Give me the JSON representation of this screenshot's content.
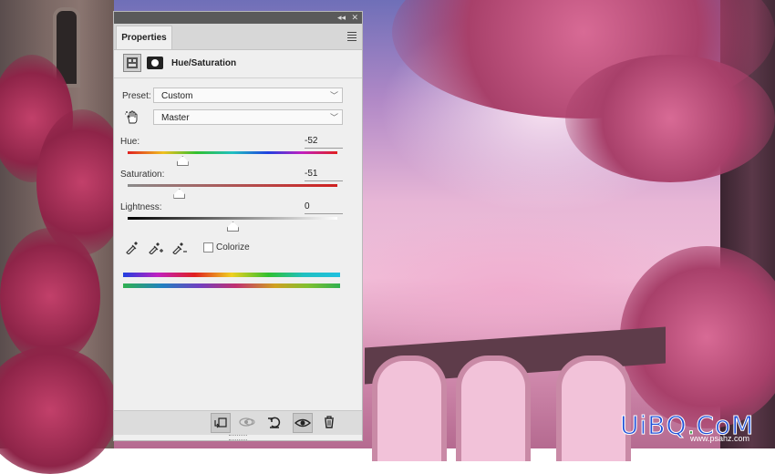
{
  "panel": {
    "tab_label": "Properties",
    "title": "Hue/Saturation",
    "preset_label": "Preset:",
    "preset_value": "Custom",
    "channel_value": "Master",
    "hue": {
      "label": "Hue:",
      "value": "-52",
      "position": 0.26
    },
    "saturation": {
      "label": "Saturation:",
      "value": "-51",
      "position": 0.245
    },
    "lightness": {
      "label": "Lightness:",
      "value": "0",
      "position": 0.5
    },
    "colorize_label": "Colorize",
    "colorize_checked": false
  },
  "icons": {
    "collapse": "double-left-arrow-icon",
    "close": "close-icon",
    "menu": "panel-menu-icon",
    "adjustment": "hue-saturation-adjustment-icon",
    "mask": "layer-mask-icon",
    "hand": "on-image-adjust-hand-icon",
    "eyedropper": "eyedropper-icon",
    "eyedropper_add": "eyedropper-plus-icon",
    "eyedropper_subtract": "eyedropper-minus-icon",
    "clip": "clip-to-layer-icon",
    "view_previous": "view-previous-state-icon",
    "reset": "reset-icon",
    "visibility": "eye-visibility-icon",
    "delete": "trash-icon"
  },
  "watermark": {
    "text_a": "UiBQ",
    "text_b": ".",
    "text_c": "CoM",
    "subtext": "www.psahz.com"
  },
  "colors": {
    "accent_blue": "#2050d8",
    "panel_bg": "#efefef"
  }
}
